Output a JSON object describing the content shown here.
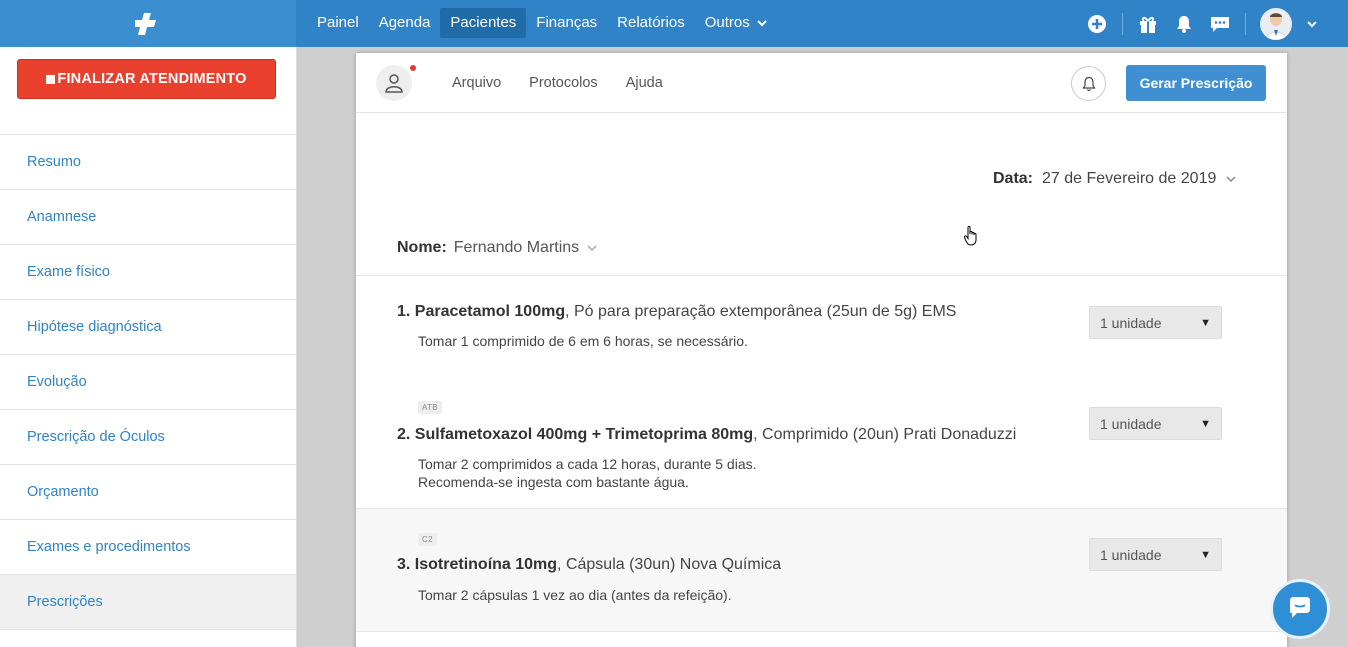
{
  "nav": {
    "items": [
      {
        "label": "Painel",
        "active": false
      },
      {
        "label": "Agenda",
        "active": false
      },
      {
        "label": "Pacientes",
        "active": true
      },
      {
        "label": "Finanças",
        "active": false
      },
      {
        "label": "Relatórios",
        "active": false
      },
      {
        "label": "Outros",
        "active": false
      }
    ]
  },
  "sidebar": {
    "finish_label": "FINALIZAR ATENDIMENTO",
    "items": [
      {
        "label": "Resumo"
      },
      {
        "label": "Anamnese"
      },
      {
        "label": "Exame físico"
      },
      {
        "label": "Hipótese diagnóstica"
      },
      {
        "label": "Evolução"
      },
      {
        "label": "Prescrição de Óculos"
      },
      {
        "label": "Orçamento"
      },
      {
        "label": "Exames e procedimentos"
      },
      {
        "label": "Prescrições"
      }
    ]
  },
  "card": {
    "menu": [
      "Arquivo",
      "Protocolos",
      "Ajuda"
    ],
    "generate_label": "Gerar Prescrição",
    "date_label": "Data:",
    "date_value": "27 de Fevereiro de 2019",
    "name_label": "Nome:",
    "name_value": "Fernando Martins"
  },
  "prescriptions": [
    {
      "number": "1.",
      "drug": "Paracetamol 100mg",
      "detail": ", Pó para preparação extemporânea (25un de 5g) EMS",
      "notes": [
        "Tomar 1 comprimido de 6 em 6 horas, se necessário."
      ],
      "badge": "",
      "quantity": "1 unidade"
    },
    {
      "number": "2.",
      "drug": "Sulfametoxazol 400mg + Trimetoprima 80mg",
      "detail": ", Comprimido (20un) Prati Donaduzzi",
      "notes": [
        "Tomar 2 comprimidos a cada 12 horas, durante 5 dias.",
        "Recomenda-se ingesta com bastante água."
      ],
      "badge": "ATB",
      "quantity": "1 unidade"
    },
    {
      "number": "3.",
      "drug": "Isotretinoína 10mg",
      "detail": ", Cápsula (30un) Nova Química",
      "notes": [
        "Tomar 2 cápsulas 1 vez ao dia (antes da refeição)."
      ],
      "badge": "C2",
      "quantity": "1 unidade"
    }
  ],
  "colors": {
    "brand": "#2f83c6",
    "danger": "#e9412d"
  }
}
